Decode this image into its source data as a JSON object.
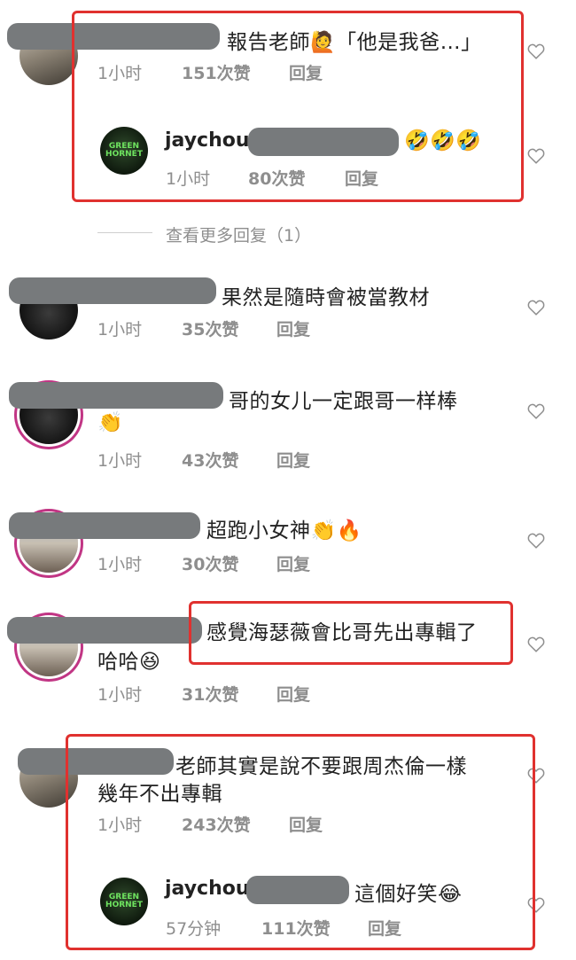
{
  "comments": [
    {
      "text": "報告老師🙋「他是我爸…」",
      "time": "1小时",
      "likes": "151次赞",
      "reply": "回复",
      "reply_item": {
        "name": "jaychou",
        "text": "🤣🤣🤣",
        "time": "1小时",
        "likes": "80次赞",
        "reply": "回复"
      },
      "more_replies": "查看更多回复（1）"
    },
    {
      "text": "果然是隨時會被當教材",
      "time": "1小时",
      "likes": "35次赞",
      "reply": "回复"
    },
    {
      "text": "哥的女儿一定跟哥一样棒",
      "text2": "👏",
      "time": "1小时",
      "likes": "43次赞",
      "reply": "回复"
    },
    {
      "text": "超跑小女神👏🔥",
      "time": "1小时",
      "likes": "30次赞",
      "reply": "回复"
    },
    {
      "text": "感覺海瑟薇會比哥先出專輯了",
      "text2": "哈哈😆",
      "time": "1小时",
      "likes": "31次赞",
      "reply": "回复"
    },
    {
      "text": "老師其實是說不要跟周杰倫一樣",
      "text2": "幾年不出專輯",
      "time": "1小时",
      "likes": "243次赞",
      "reply": "回复",
      "reply_item": {
        "name": "jaychou",
        "text": "這個好笑😂",
        "time": "57分钟",
        "likes": "111次赞",
        "reply": "回复"
      }
    }
  ],
  "avatar_label": "GREEN HORNET",
  "colors": {
    "highlight": "#e0312f",
    "meta": "#8e8e8e",
    "story_ring": "#c13584"
  }
}
